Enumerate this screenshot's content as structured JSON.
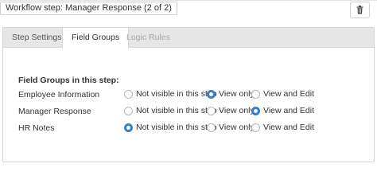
{
  "header": {
    "title": "Workflow step: Manager Response (2 of 2)",
    "delete_icon": "trash-icon"
  },
  "tabs": [
    {
      "label": "Step Settings",
      "state": "inactive"
    },
    {
      "label": "Field Groups",
      "state": "active"
    },
    {
      "label": "Logic Rules",
      "state": "disabled"
    }
  ],
  "field_groups": {
    "heading": "Field Groups in this step:",
    "options": [
      "Not visible in this step",
      "View only",
      "View and Edit"
    ],
    "rows": [
      {
        "label": "Employee Information",
        "selected": "View only"
      },
      {
        "label": "Manager Response",
        "selected": "View and Edit"
      },
      {
        "label": "HR Notes",
        "selected": "Not visible in this step"
      }
    ]
  },
  "colors": {
    "accent": "#3a7fc4",
    "tab_bar": "#e6e6e6",
    "border": "#d6d6d6"
  }
}
